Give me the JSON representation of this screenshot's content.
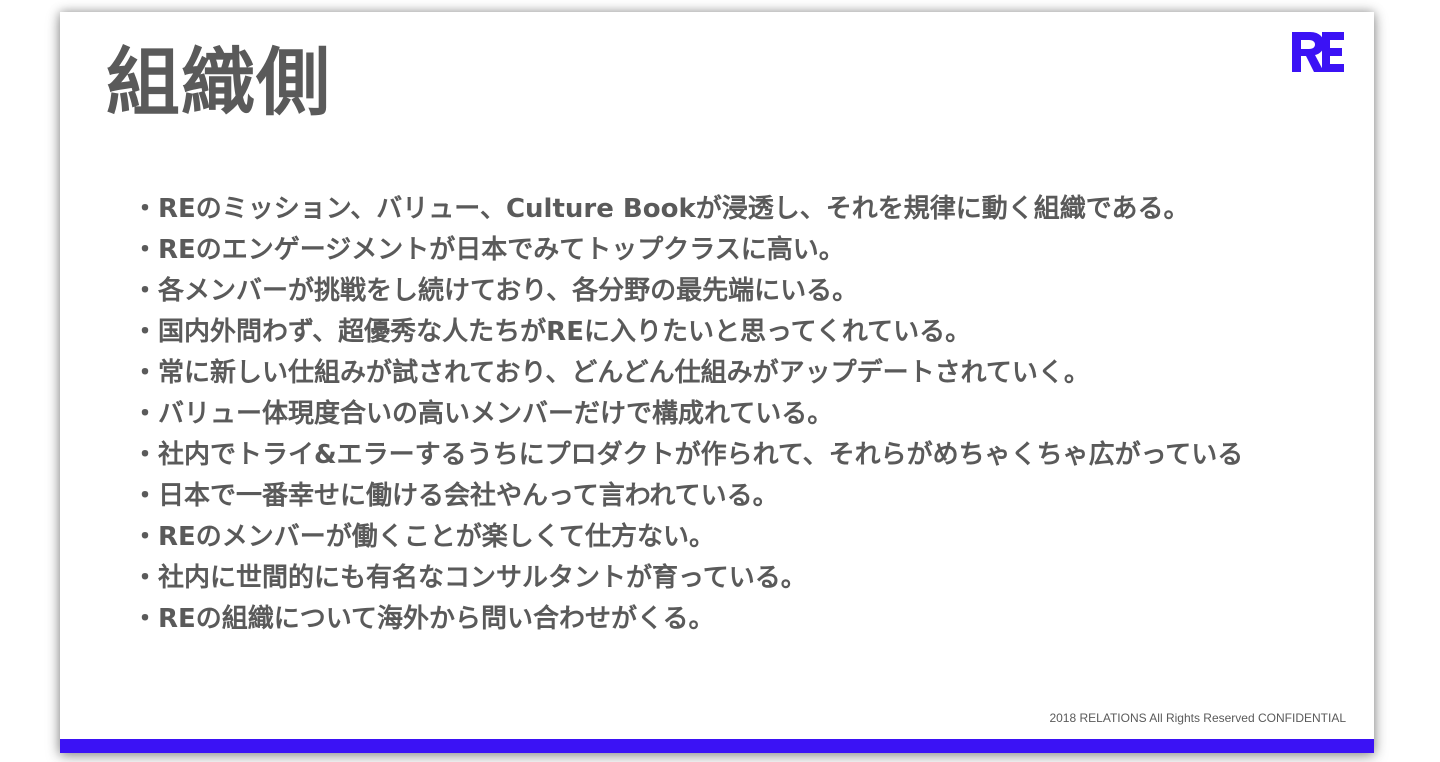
{
  "slide": {
    "title": "組織側",
    "bullet_mark": "・",
    "items": [
      "REのミッション、バリュー、Culture Bookが浸透し、それを規律に動く組織である。",
      "REのエンゲージメントが日本でみてトップクラスに高い。",
      "各メンバーが挑戦をし続けており、各分野の最先端にいる。",
      "国内外問わず、超優秀な人たちがREに入りたいと思ってくれている。",
      "常に新しい仕組みが試されており、どんどん仕組みがアップデートされていく。",
      "バリュー体現度合いの高いメンバーだけで構成れている。",
      "社内でトライ&エラーするうちにプロダクトが作られて、それらがめちゃくちゃ広がっている",
      "日本で一番幸せに働ける会社やんって言われている。",
      "REのメンバーが働くことが楽しくて仕方ない。",
      "社内に世間的にも有名なコンサルタントが育っている。",
      "REの組織について海外から問い合わせがくる。"
    ],
    "footer": "2018 RELATIONS All Rights Reserved CONFIDENTIAL",
    "logo": {
      "icon": "re-logo-icon",
      "color": "#3b12f5"
    },
    "accent_color": "#3b12f5",
    "text_color": "#5a5a5a"
  }
}
